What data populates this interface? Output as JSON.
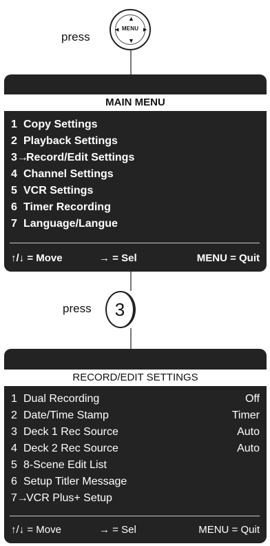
{
  "step1": {
    "press_label": "press",
    "button_text": "MENU",
    "arrows": {
      "up": "▲",
      "down": "▼",
      "left": "◀",
      "right": "▶"
    }
  },
  "main_menu": {
    "title": "MAIN MENU",
    "items": [
      {
        "num": "1",
        "label": "Copy Settings"
      },
      {
        "num": "2",
        "label": "Playback Settings"
      },
      {
        "num": "3→",
        "label": "Record/Edit Settings",
        "selected": true
      },
      {
        "num": "4",
        "label": "Channel Settings"
      },
      {
        "num": "5",
        "label": "VCR Settings"
      },
      {
        "num": "6",
        "label": "Timer Recording"
      },
      {
        "num": "7",
        "label": "Language/Langue"
      }
    ],
    "footer": {
      "move": "↑/↓ = Move",
      "sel": "→ = Sel",
      "quit": "MENU = Quit"
    }
  },
  "step2": {
    "press_label": "press",
    "button_text": "3"
  },
  "record_edit_menu": {
    "title": "RECORD/EDIT SETTINGS",
    "items": [
      {
        "num": "1",
        "label": "Dual Recording",
        "value": "Off"
      },
      {
        "num": "2",
        "label": "Date/Time Stamp",
        "value": "Timer"
      },
      {
        "num": "3",
        "label": "Deck 1 Rec Source",
        "value": "Auto"
      },
      {
        "num": "4",
        "label": "Deck 2 Rec Source",
        "value": "Auto"
      },
      {
        "num": "5",
        "label": "8-Scene Edit List",
        "value": ""
      },
      {
        "num": "6",
        "label": "Setup Titler Message",
        "value": ""
      },
      {
        "num": "7→",
        "label": "VCR Plus+ Setup",
        "value": "",
        "selected": true
      }
    ],
    "footer": {
      "move": "↑/↓ = Move",
      "sel": "→ = Sel",
      "quit": "MENU = Quit"
    }
  },
  "colors": {
    "panel_bg": "#232323",
    "title_bar": "#ffffff",
    "menu_text": "#ffffff",
    "connector": "#777777"
  }
}
